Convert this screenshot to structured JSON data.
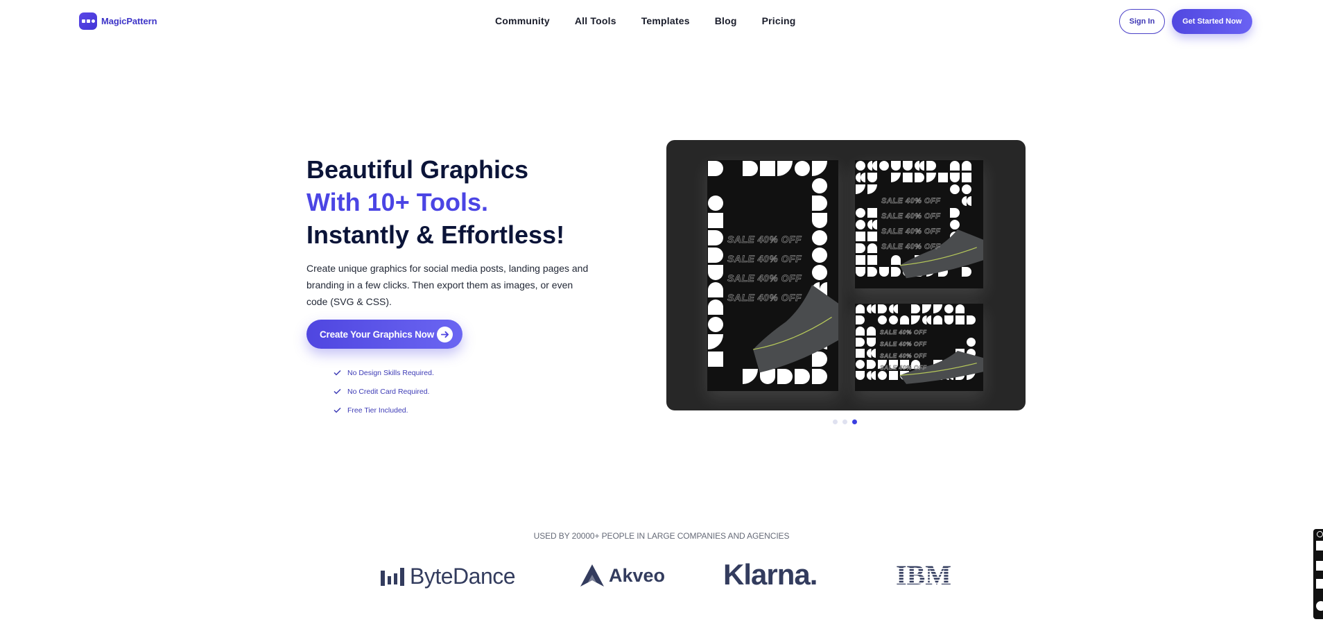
{
  "nav": {
    "brand": "MagicPattern",
    "links": [
      "Community",
      "All Tools",
      "Templates",
      "Blog",
      "Pricing"
    ],
    "sign_in": "Sign In",
    "get_started": "Get Started Now"
  },
  "hero": {
    "title_line1": "Beautiful Graphics",
    "title_line2": "With 10+ Tools.",
    "title_line3": "Instantly & Effortless!",
    "description": "Create unique graphics for social media posts, landing pages and branding in a few clicks. Then export them as images, or even code (SVG & CSS).",
    "cta_label": "Create Your Graphics Now",
    "checks": [
      "No Design Skills Required.",
      "No Credit Card Required.",
      "Free Tier Included."
    ]
  },
  "showcase": {
    "sale_text": "SALE 40% OFF",
    "carousel": {
      "count": 3,
      "active_index": 2
    }
  },
  "social_proof": {
    "heading": "USED BY 20000+ PEOPLE IN LARGE COMPANIES AND AGENCIES",
    "companies": [
      "ByteDance",
      "Akveo",
      "Klarna.",
      "IBM"
    ]
  },
  "colors": {
    "accent": "#4b45e4",
    "heading": "#0b1438",
    "logo_gray": "#333c5e",
    "showcase_bg": "#272727"
  }
}
